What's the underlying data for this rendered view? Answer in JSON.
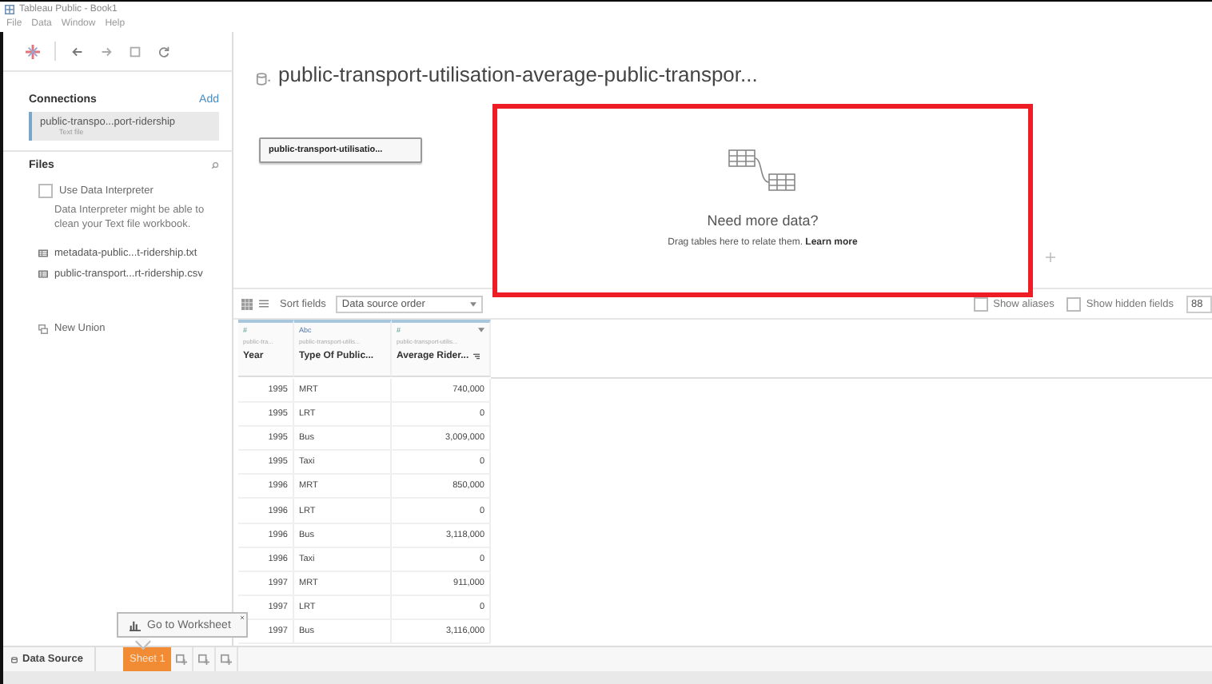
{
  "window": {
    "title": "Tableau Public - Book1"
  },
  "menu": [
    "File",
    "Data",
    "Window",
    "Help"
  ],
  "connections": {
    "title": "Connections",
    "add": "Add",
    "items": [
      {
        "name": "public-transpo...port-ridership",
        "type": "Text file",
        "selected": true
      }
    ]
  },
  "files": {
    "title": "Files",
    "interpreter": {
      "label": "Use Data Interpreter",
      "checked": false,
      "hint": "Data Interpreter might be able to clean your Text file workbook."
    },
    "items": [
      "metadata-public...t-ridership.txt",
      "public-transport...rt-ridership.csv"
    ],
    "new_union": "New Union"
  },
  "source": {
    "title": "public-transport-utilisation-average-public-transpor...",
    "table": "public-transport-utilisatio...",
    "drop_zone": {
      "heading": "Need more data?",
      "text": "Drag tables here to relate them.",
      "link": "Learn more",
      "highlighted": true
    }
  },
  "grid_toolbar": {
    "sort_label": "Sort fields",
    "sort_value": "Data source order",
    "show_aliases": {
      "label": "Show aliases",
      "checked": false
    },
    "show_hidden": {
      "label": "Show hidden fields",
      "checked": false
    },
    "rows": "88"
  },
  "columns": [
    {
      "type": "#",
      "source": "public-tra...",
      "name": "Year",
      "kind": "number"
    },
    {
      "type": "Abc",
      "source": "public-transport-utilis...",
      "name": "Type Of Public...",
      "kind": "text"
    },
    {
      "type": "#",
      "source": "public-transport-utilis...",
      "name": "Average Rider...",
      "kind": "number"
    }
  ],
  "rows": [
    [
      "1995",
      "MRT",
      "740,000"
    ],
    [
      "1995",
      "LRT",
      "0"
    ],
    [
      "1995",
      "Bus",
      "3,009,000"
    ],
    [
      "1995",
      "Taxi",
      "0"
    ],
    [
      "1996",
      "MRT",
      "850,000"
    ],
    [
      "1996",
      "LRT",
      "0"
    ],
    [
      "1996",
      "Bus",
      "3,118,000"
    ],
    [
      "1996",
      "Taxi",
      "0"
    ],
    [
      "1997",
      "MRT",
      "911,000"
    ],
    [
      "1997",
      "LRT",
      "0"
    ],
    [
      "1997",
      "Bus",
      "3,116,000"
    ]
  ],
  "tooltip": "Go to Worksheet",
  "tabs": [
    {
      "label": "Data Source",
      "kind": "source"
    },
    {
      "label": "Sheet 1",
      "kind": "sheet"
    }
  ]
}
